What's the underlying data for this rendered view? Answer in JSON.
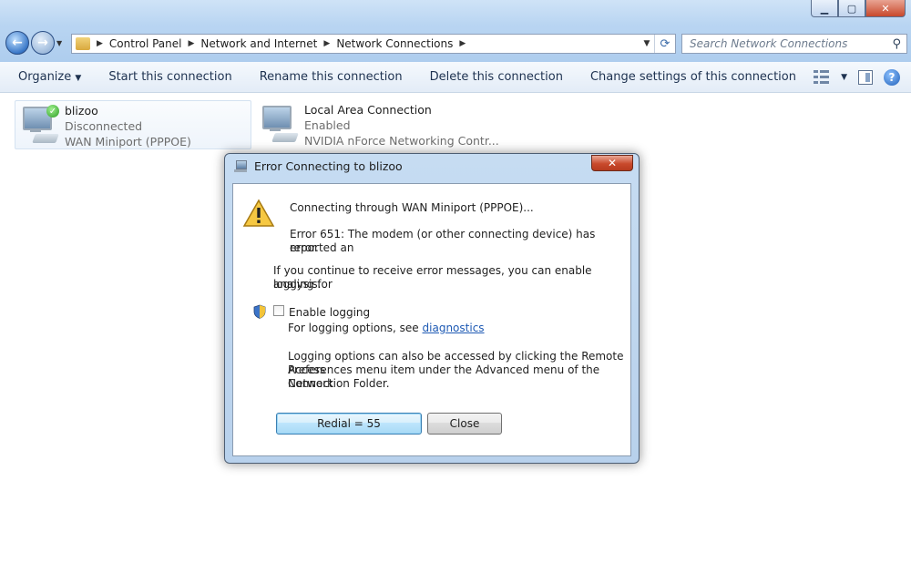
{
  "address": {
    "crumbs": [
      "Control Panel",
      "Network and Internet",
      "Network Connections"
    ]
  },
  "search": {
    "placeholder": "Search Network Connections"
  },
  "toolbar": {
    "organize": "Organize",
    "start": "Start this connection",
    "rename": "Rename this connection",
    "delete": "Delete this connection",
    "change": "Change settings of this connection"
  },
  "connections": [
    {
      "name": "blizoo",
      "status": "Disconnected",
      "device": "WAN Miniport (PPPOE)"
    },
    {
      "name": "Local Area Connection",
      "status": "Enabled",
      "device": "NVIDIA nForce Networking Contr..."
    }
  ],
  "dialog": {
    "title": "Error Connecting to blizoo",
    "connecting": "Connecting through WAN Miniport (PPPOE)...",
    "error_line1": "Error 651: The modem (or other connecting device) has reported an",
    "error_line2": "error.",
    "continue_line1": "If you continue to receive error messages, you can enable logging for",
    "continue_line2": "analysis.",
    "enable_logging": "Enable logging",
    "logging_options_prefix": "For logging options, see",
    "diagnostics_link": "diagnostics",
    "access_line1": "Logging options can also be accessed by clicking the Remote Access",
    "access_line2": "Preferences menu item under the Advanced menu of the Network",
    "access_line3": "Connection Folder.",
    "redial_button": "Redial = 55",
    "close_button": "Close"
  }
}
